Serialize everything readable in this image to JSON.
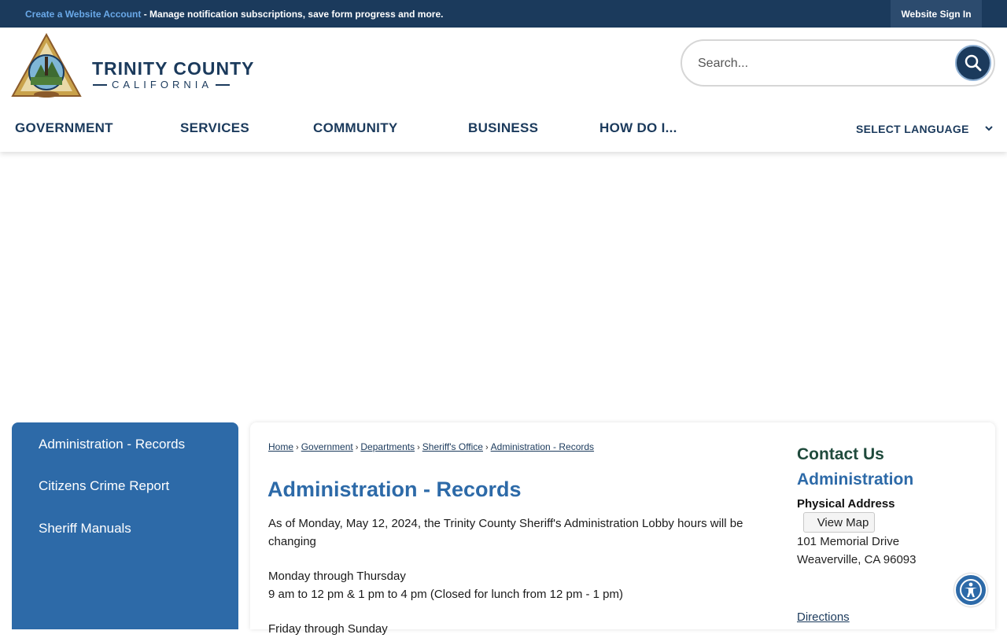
{
  "topbar": {
    "create_link": "Create a Website Account",
    "message": " - Manage notification subscriptions, save form progress and more.",
    "signin": "Website Sign In"
  },
  "header": {
    "logo_title": "TRINITY COUNTY",
    "logo_subtitle": "CALIFORNIA",
    "search_placeholder": "Search...",
    "nav": [
      "GOVERNMENT",
      "SERVICES",
      "COMMUNITY",
      "BUSINESS",
      "HOW DO I..."
    ],
    "language": "SELECT LANGUAGE"
  },
  "sidebar": {
    "items": [
      "Administration - Records",
      "Citizens Crime Report",
      "Sheriff Manuals"
    ]
  },
  "breadcrumb": [
    "Home",
    "Government",
    "Departments",
    "Sheriff's Office",
    "Administration - Records"
  ],
  "main": {
    "title": "Administration - Records",
    "paragraphs": [
      "As of Monday, May 12, 2024, the Trinity County Sheriff's Administration Lobby hours will be changing",
      "Monday through Thursday",
      "9 am to 12 pm & 1 pm to 4 pm (Closed for lunch from 12 pm - 1 pm)",
      "Friday through Sunday"
    ]
  },
  "contact": {
    "heading": "Contact Us",
    "department": "Administration",
    "address_label": "Physical Address",
    "map_button": "View Map",
    "address_line1": "101 Memorial Drive",
    "address_line2": "Weaverville, CA 96093",
    "directions": "Directions"
  },
  "colors": {
    "navy": "#1b3a5c",
    "blue": "#2d6aa8",
    "link_light": "#6aa9e9",
    "contact_green": "#1f4a3c"
  },
  "icons": [
    "search-icon",
    "chevron-down-icon",
    "accessibility-icon",
    "county-seal-logo"
  ]
}
